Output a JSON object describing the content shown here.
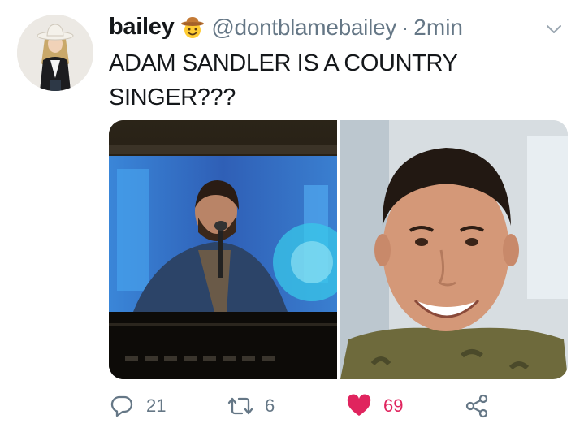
{
  "tweet": {
    "display_name": "bailey",
    "name_emoji": "cowboy-hat-face-emoji",
    "handle": "@dontblamebailey",
    "separator": "·",
    "timestamp": "2min",
    "text": "ADAM SANDLER IS A COUNTRY SINGER???",
    "media": [
      {
        "alt": "TV screen showing a bearded country singer at a microphone"
      },
      {
        "alt": "Adam Sandler smiling"
      }
    ],
    "actions": {
      "reply_count": "21",
      "retweet_count": "6",
      "like_count": "69"
    }
  },
  "colors": {
    "text": "#14171a",
    "secondary": "#657786",
    "like": "#e0245e"
  },
  "icons": [
    "profile-avatar",
    "cowboy-hat-face-emoji",
    "chevron-down-icon",
    "reply-icon",
    "retweet-icon",
    "heart-icon",
    "share-icon"
  ]
}
